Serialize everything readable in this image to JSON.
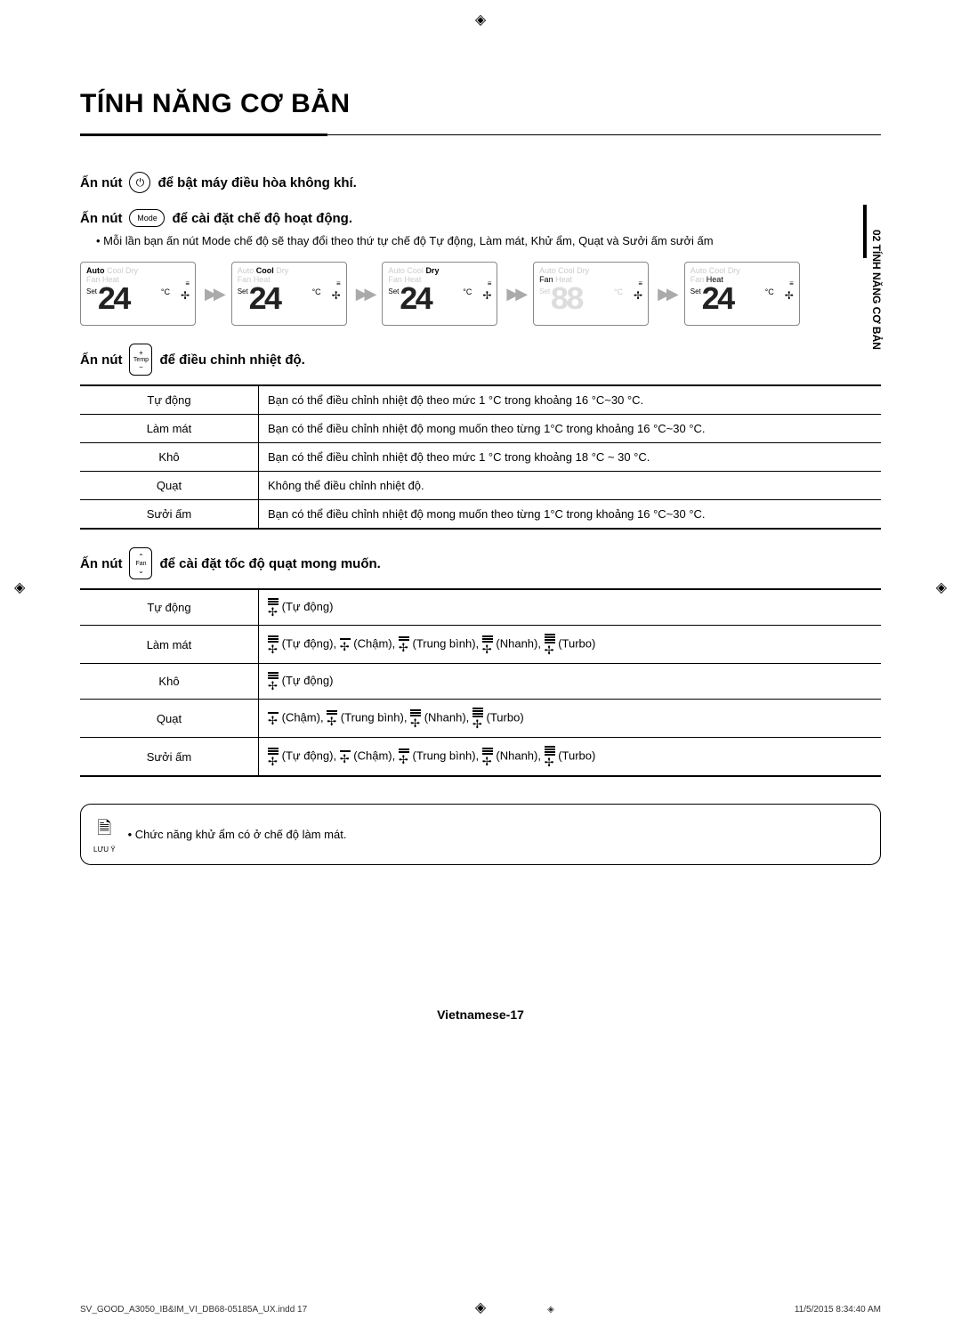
{
  "title": "TÍNH NĂNG CƠ BẢN",
  "side_tab": "02  TÍNH NĂNG CƠ BẢN",
  "instr1": {
    "prefix": "Ấn nút",
    "button": "⏻",
    "suffix": "để bật máy điều hòa không khí."
  },
  "instr2": {
    "prefix": "Ấn nút",
    "button": "Mode",
    "suffix": "để cài đặt chế độ hoạt động."
  },
  "bullet_mode": "Mỗi lần bạn ấn nút Mode chế độ sẽ thay đổi theo thứ tự chế độ Tự động, Làm mát, Khử ẩm, Quạt và Sưởi ấm sưởi ấm",
  "lcd_labels": {
    "auto": "Auto",
    "cool": "Cool",
    "dry": "Dry",
    "fan": "Fan",
    "heat": "Heat",
    "set": "Set",
    "unit": "°C",
    "temp": "24",
    "blank": "88"
  },
  "modes_sequence": [
    "Auto",
    "Cool",
    "Dry",
    "Fan",
    "Heat"
  ],
  "instr3": {
    "prefix": "Ấn nút",
    "button_lines": [
      "+",
      "Temp",
      "−"
    ],
    "suffix": "để điều chỉnh nhiệt độ."
  },
  "temp_table": [
    {
      "mode": "Tự động",
      "desc": "Bạn có thể điều chỉnh nhiệt độ theo mức 1 °C trong khoảng 16 °C~30 °C."
    },
    {
      "mode": "Làm mát",
      "desc": "Bạn có thể điều chỉnh nhiệt độ mong muốn theo từng 1°C trong khoảng 16 °C~30 °C."
    },
    {
      "mode": "Khô",
      "desc": "Bạn có thể điều chỉnh nhiệt độ theo mức 1 °C trong khoảng 18 °C ~ 30 °C."
    },
    {
      "mode": "Quạt",
      "desc": "Không thể điều chỉnh nhiệt độ."
    },
    {
      "mode": "Sưởi ấm",
      "desc": "Bạn có thể điều chỉnh nhiệt độ mong muốn theo từng 1°C trong khoảng 16 °C~30 °C."
    }
  ],
  "instr4": {
    "prefix": "Ấn nút",
    "button_lines": [
      "⌃",
      "Fan",
      "⌄"
    ],
    "suffix": "để cài đặt tốc độ quạt mong muốn."
  },
  "fan_labels": {
    "auto": "(Tự động)",
    "slow": "(Chậm)",
    "med": "(Trung bình)",
    "fast": "(Nhanh)",
    "turbo": "(Turbo)"
  },
  "fan_table": [
    {
      "mode": "Tự động",
      "speeds": [
        "auto"
      ]
    },
    {
      "mode": "Làm mát",
      "speeds": [
        "auto",
        "slow",
        "med",
        "fast",
        "turbo"
      ]
    },
    {
      "mode": "Khô",
      "speeds": [
        "auto"
      ]
    },
    {
      "mode": "Quạt",
      "speeds": [
        "slow",
        "med",
        "fast",
        "turbo"
      ]
    },
    {
      "mode": "Sưởi ấm",
      "speeds": [
        "auto",
        "slow",
        "med",
        "fast",
        "turbo"
      ]
    }
  ],
  "note": {
    "label": "LƯU Ý",
    "text": "Chức năng khử ẩm có ở chế độ làm mát."
  },
  "page_number": "Vietnamese-17",
  "print": {
    "file": "SV_GOOD_A3050_IB&IM_VI_DB68-05185A_UX.indd   17",
    "time": "11/5/2015   8:34:40 AM"
  }
}
